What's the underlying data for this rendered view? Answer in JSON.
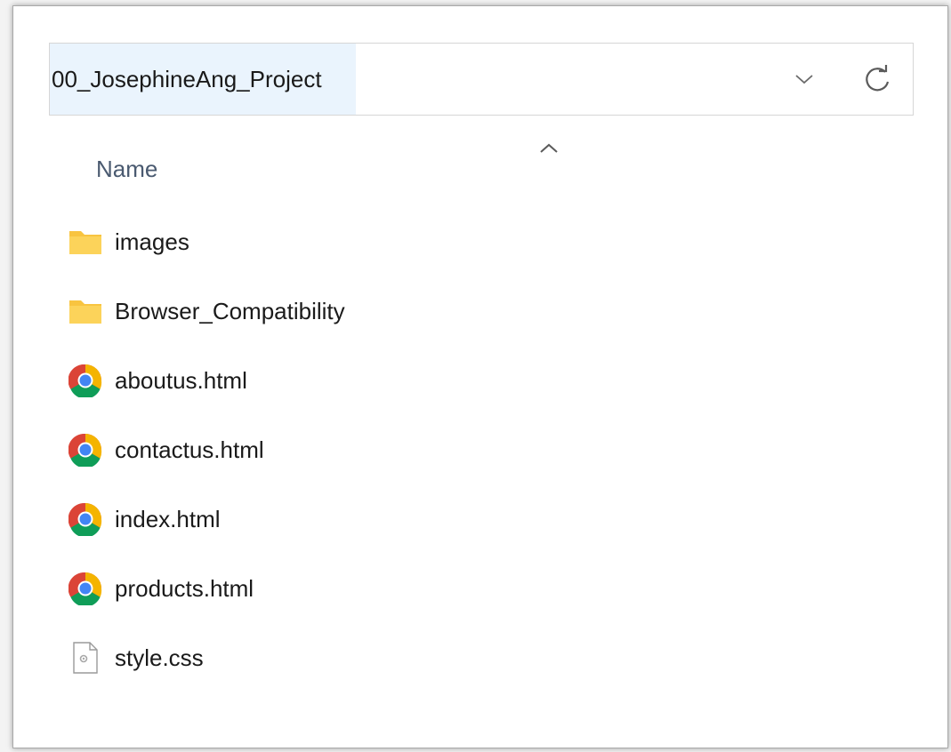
{
  "address_bar": {
    "path": "00_JosephineAng_Project"
  },
  "column_header": {
    "name_label": "Name"
  },
  "files": [
    {
      "name": "images",
      "icon": "folder-icon"
    },
    {
      "name": "Browser_Compatibility",
      "icon": "folder-icon"
    },
    {
      "name": "aboutus.html",
      "icon": "chrome-icon"
    },
    {
      "name": "contactus.html",
      "icon": "chrome-icon"
    },
    {
      "name": "index.html",
      "icon": "chrome-icon"
    },
    {
      "name": "products.html",
      "icon": "chrome-icon"
    },
    {
      "name": "style.css",
      "icon": "css-file-icon"
    }
  ],
  "colors": {
    "path_highlight": "#eaf4fd",
    "header_text": "#4a5a70",
    "folder": "#f8c440"
  }
}
